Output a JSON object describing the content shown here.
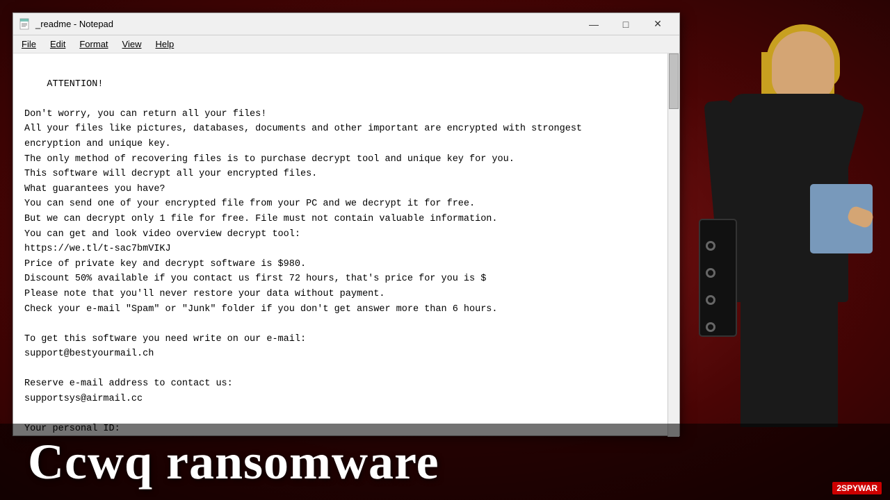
{
  "background": {
    "color": "#6b0a0a"
  },
  "titlebar": {
    "icon": "📄",
    "title": "_readme - Notepad",
    "min_btn": "—",
    "max_btn": "□",
    "close_btn": "✕"
  },
  "menubar": {
    "items": [
      "File",
      "Edit",
      "Format",
      "View",
      "Help"
    ]
  },
  "notepad": {
    "content": "ATTENTION!\n\nDon't worry, you can return all your files!\nAll your files like pictures, databases, documents and other important are encrypted with strongest\nencryption and unique key.\nThe only method of recovering files is to purchase decrypt tool and unique key for you.\nThis software will decrypt all your encrypted files.\nWhat guarantees you have?\nYou can send one of your encrypted file from your PC and we decrypt it for free.\nBut we can decrypt only 1 file for free. File must not contain valuable information.\nYou can get and look video overview decrypt tool:\nhttps://we.tl/t-sac7bmVIKJ\nPrice of private key and decrypt software is $980.\nDiscount 50% available if you contact us first 72 hours, that's price for you is $\nPlease note that you'll never restore your data without payment.\nCheck your e-mail \"Spam\" or \"Junk\" folder if you don't get answer more than 6 hours.\n\nTo get this software you need write on our e-mail:\nsupport@bestyourmail.ch\n\nReserve e-mail address to contact us:\nsupportsys@airmail.cc\n\nYour personal ID:"
  },
  "bottom_title": {
    "text": "Ccwq ransomware"
  },
  "logo": {
    "text": "2SPYWAR"
  }
}
